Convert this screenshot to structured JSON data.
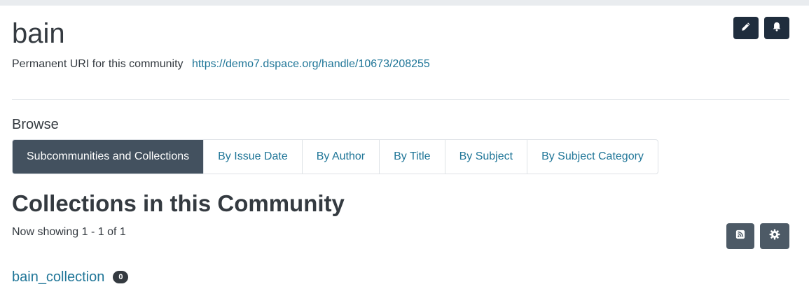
{
  "page": {
    "title": "bain",
    "uri_label": "Permanent URI for this community",
    "uri_link": "https://demo7.dspace.org/handle/10673/208255"
  },
  "header_actions": {
    "edit_icon": "pencil-icon",
    "subscribe_icon": "bell-icon"
  },
  "browse": {
    "label": "Browse",
    "tabs": [
      {
        "label": "Subcommunities and Collections",
        "active": true
      },
      {
        "label": "By Issue Date",
        "active": false
      },
      {
        "label": "By Author",
        "active": false
      },
      {
        "label": "By Title",
        "active": false
      },
      {
        "label": "By Subject",
        "active": false
      },
      {
        "label": "By Subject Category",
        "active": false
      }
    ]
  },
  "collections": {
    "title": "Collections in this Community",
    "showing": "Now showing 1 - 1 of 1",
    "rss_icon": "rss-icon",
    "settings_icon": "gear-icon",
    "items": [
      {
        "name": "bain_collection",
        "count": "0"
      }
    ]
  },
  "colors": {
    "link": "#207698",
    "active_tab": "#43515f",
    "dark_button": "#1f2d3d",
    "gray_button": "#4d5a66"
  }
}
